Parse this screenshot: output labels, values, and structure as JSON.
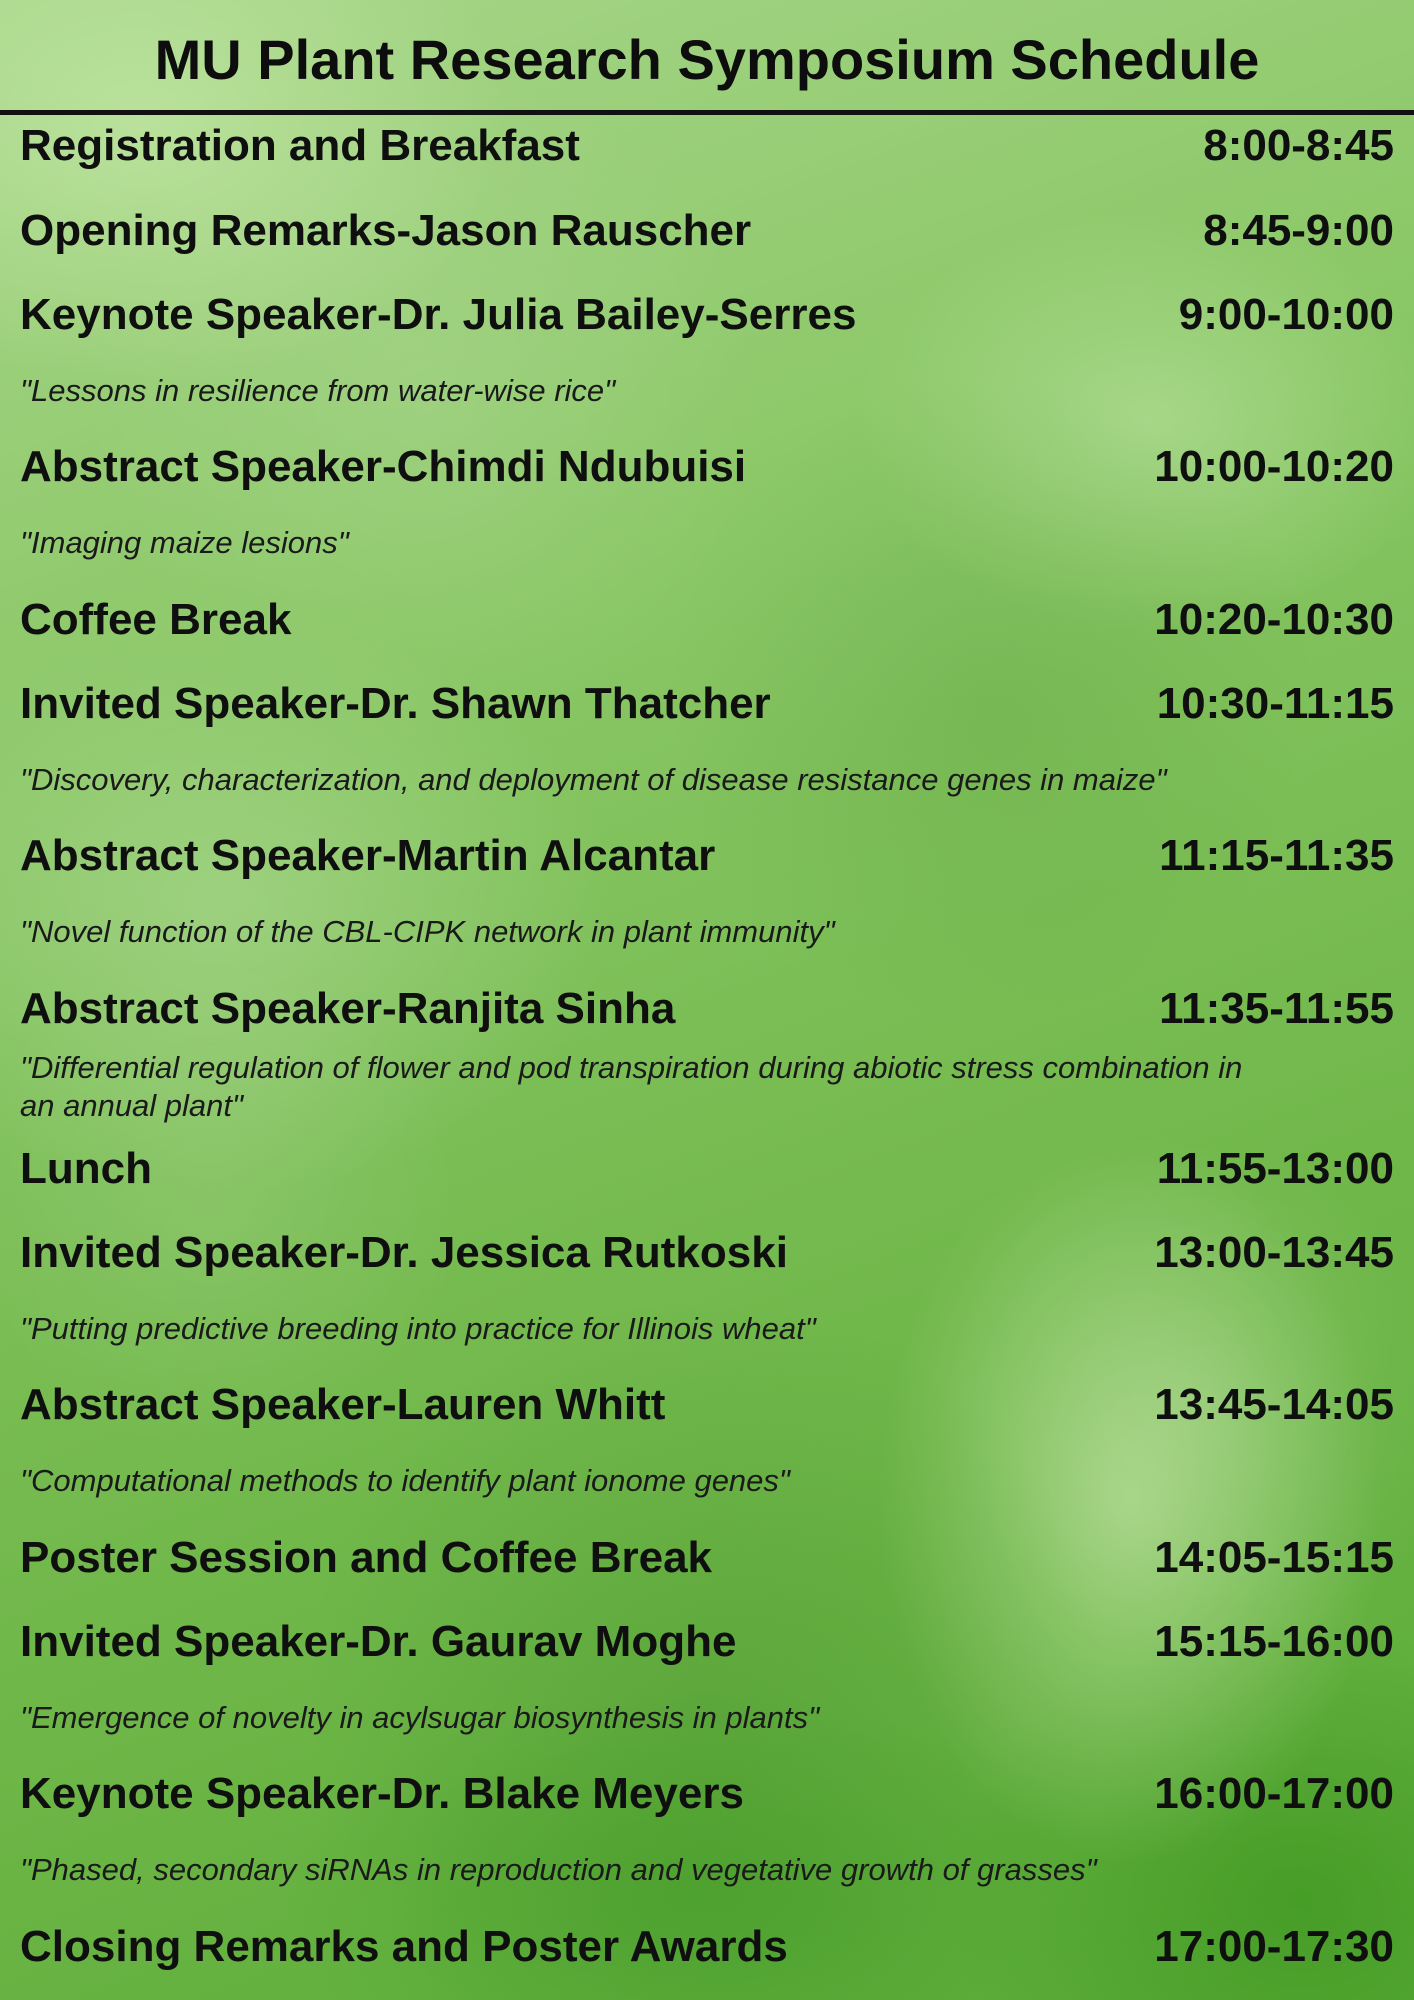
{
  "title": "MU Plant Research Symposium Schedule",
  "events": [
    {
      "name": "Registration and Breakfast",
      "time": "8:00-8:45"
    },
    {
      "name": "Opening Remarks-Jason Rauscher",
      "time": "8:45-9:00"
    },
    {
      "name": "Keynote Speaker-Dr. Julia Bailey-Serres",
      "time": "9:00-10:00",
      "talk": "\"Lessons in resilience from water-wise rice\""
    },
    {
      "name": "Abstract Speaker-Chimdi Ndubuisi",
      "time": "10:00-10:20",
      "talk": "\"Imaging maize lesions\""
    },
    {
      "name": "Coffee Break",
      "time": "10:20-10:30"
    },
    {
      "name": "Invited Speaker-Dr. Shawn Thatcher",
      "time": "10:30-11:15",
      "talk": "\"Discovery, characterization, and deployment of disease resistance genes in maize\""
    },
    {
      "name": "Abstract Speaker-Martin Alcantar",
      "time": "11:15-11:35",
      "talk": "\"Novel function of the CBL-CIPK network in plant immunity\""
    },
    {
      "name": "Abstract Speaker-Ranjita Sinha",
      "time": "11:35-11:55",
      "talk": "\"Differential regulation of flower and pod transpiration during abiotic stress combination in an annual plant\""
    },
    {
      "name": "Lunch",
      "time": "11:55-13:00"
    },
    {
      "name": "Invited Speaker-Dr. Jessica Rutkoski",
      "time": "13:00-13:45",
      "talk": "\"Putting predictive breeding into practice for Illinois wheat\""
    },
    {
      "name": "Abstract Speaker-Lauren Whitt",
      "time": "13:45-14:05",
      "talk": "\"Computational methods to identify plant ionome genes\""
    },
    {
      "name": "Poster Session and Coffee Break",
      "time": "14:05-15:15"
    },
    {
      "name": "Invited Speaker-Dr. Gaurav Moghe",
      "time": "15:15-16:00",
      "talk": "\"Emergence of novelty in acylsugar biosynthesis in plants\""
    },
    {
      "name": "Keynote Speaker-Dr. Blake Meyers",
      "time": "16:00-17:00",
      "talk": "\"Phased, secondary siRNAs in reproduction and vegetative growth of grasses\""
    },
    {
      "name": "Closing Remarks and Poster Awards",
      "time": "17:00-17:30"
    }
  ]
}
